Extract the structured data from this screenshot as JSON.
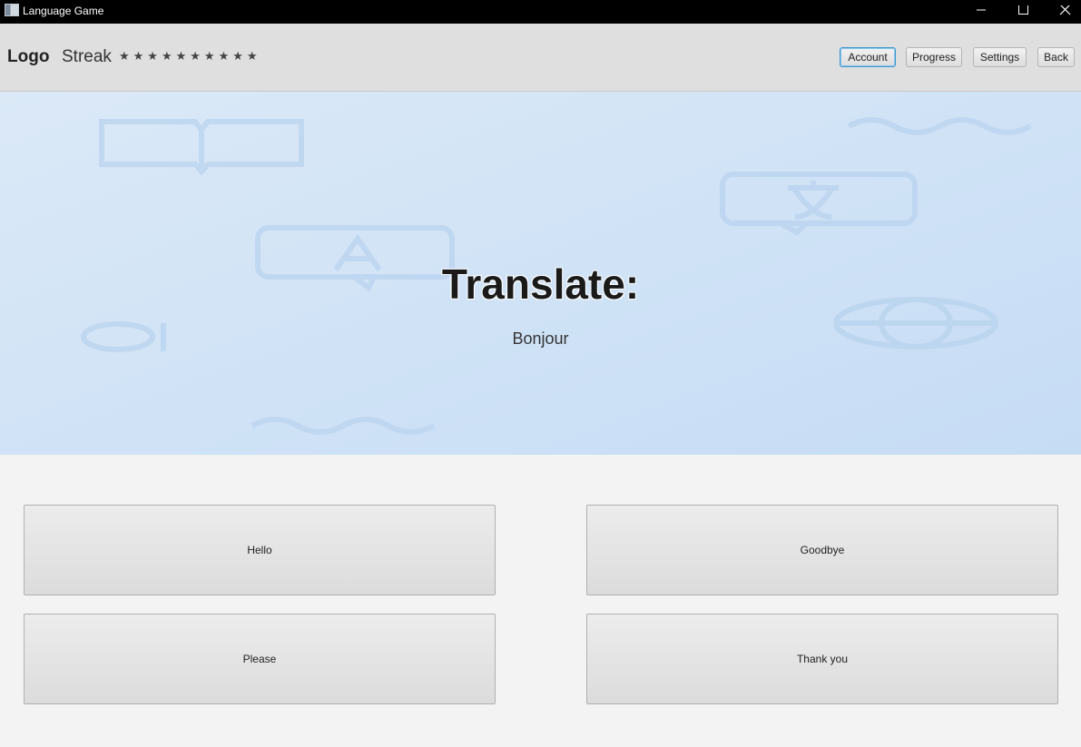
{
  "window": {
    "title": "Language Game",
    "icons": {
      "minimize": "minimize-icon",
      "maximize": "maximize-icon",
      "close": "close-icon"
    }
  },
  "header": {
    "logo": "Logo",
    "streak_label": "Streak",
    "streak_stars": "★★★★★★★★★★",
    "buttons": {
      "account": "Account",
      "progress": "Progress",
      "settings": "Settings",
      "back": "Back"
    }
  },
  "prompt": {
    "title": "Translate:",
    "word": "Bonjour"
  },
  "answers": [
    "Hello",
    "Goodbye",
    "Please",
    "Thank you"
  ],
  "colors": {
    "hero_gradient_start": "#dbe9f7",
    "hero_gradient_end": "#c6dcf5",
    "focus_accent": "#3a98d0"
  }
}
